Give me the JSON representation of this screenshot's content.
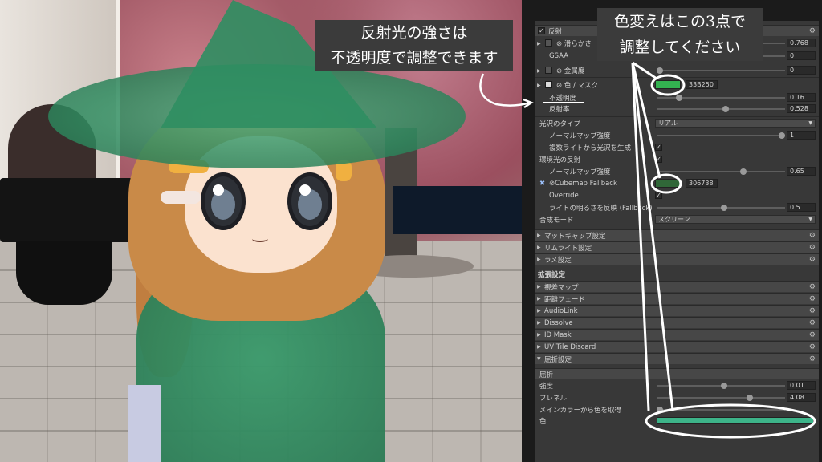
{
  "callouts": {
    "top_left_line1": "反射光の強さは",
    "top_left_line2": "不透明度で調整できます",
    "top_right_line1": "色変えはこの3点で",
    "top_right_line2": "調整してください"
  },
  "inspector": {
    "reflection_header": "反射",
    "smoothness_label": "滑らかさ",
    "smoothness_value": "0.768",
    "gsaa_label": "GSAA",
    "gsaa_value": "0",
    "metallic_label": "金属度",
    "metallic_value": "0",
    "color_mask_label": "色 / マスク",
    "color_hex": "33B250",
    "opacity_label": "不透明度",
    "opacity_value": "0.16",
    "reflectance_label": "反射率",
    "reflectance_value": "0.528",
    "gloss_type_label": "光沢のタイプ",
    "gloss_type_value": "リアル",
    "normal_map_strength_label": "ノーマルマップ強度",
    "normal_map_strength_value": "1",
    "multi_light_label": "複数ライトから光沢を生成",
    "env_reflection_label": "環境光の反射",
    "env_normal_map_label": "ノーマルマップ強度",
    "env_normal_map_value": "0.65",
    "cubemap_label": "Cubemap Fallback",
    "cubemap_hex": "306738",
    "override_label": "Override",
    "light_brightness_label": "ライトの明るさを反映 (Fallback)",
    "light_brightness_value": "0.5",
    "blend_mode_label": "合成モード",
    "blend_mode_value": "スクリーン",
    "matcap_label": "マットキャップ設定",
    "rimlight_label": "リムライト設定",
    "glitter_label": "ラメ設定",
    "extended_label": "拡張設定",
    "parallax_label": "視差マップ",
    "distance_fade_label": "距離フェード",
    "audiolink_label": "AudioLink",
    "dissolve_label": "Dissolve",
    "idmask_label": "ID Mask",
    "uvtile_label": "UV Tile Discard",
    "refraction_settings_label": "屈折設定",
    "refraction_header": "屈折",
    "strength_label": "強度",
    "strength_value": "0.01",
    "fresnel_label": "フレネル",
    "fresnel_value": "4.08",
    "main_color_label": "メインカラーから色を取得",
    "color_label": "色"
  },
  "colors": {
    "swatch_green": "#33B250",
    "cubemap_green": "#306738",
    "refraction_color": "#3DB489"
  }
}
